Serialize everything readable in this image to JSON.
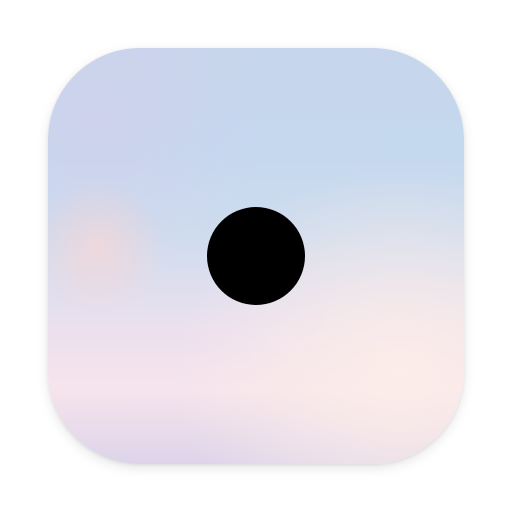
{
  "icon": {
    "shape": "rounded-square",
    "background": {
      "colors": [
        "#c7d6ec",
        "#cfdcee",
        "#f6e4ec",
        "#ddd4ea"
      ]
    },
    "dot_color": "#000000"
  }
}
